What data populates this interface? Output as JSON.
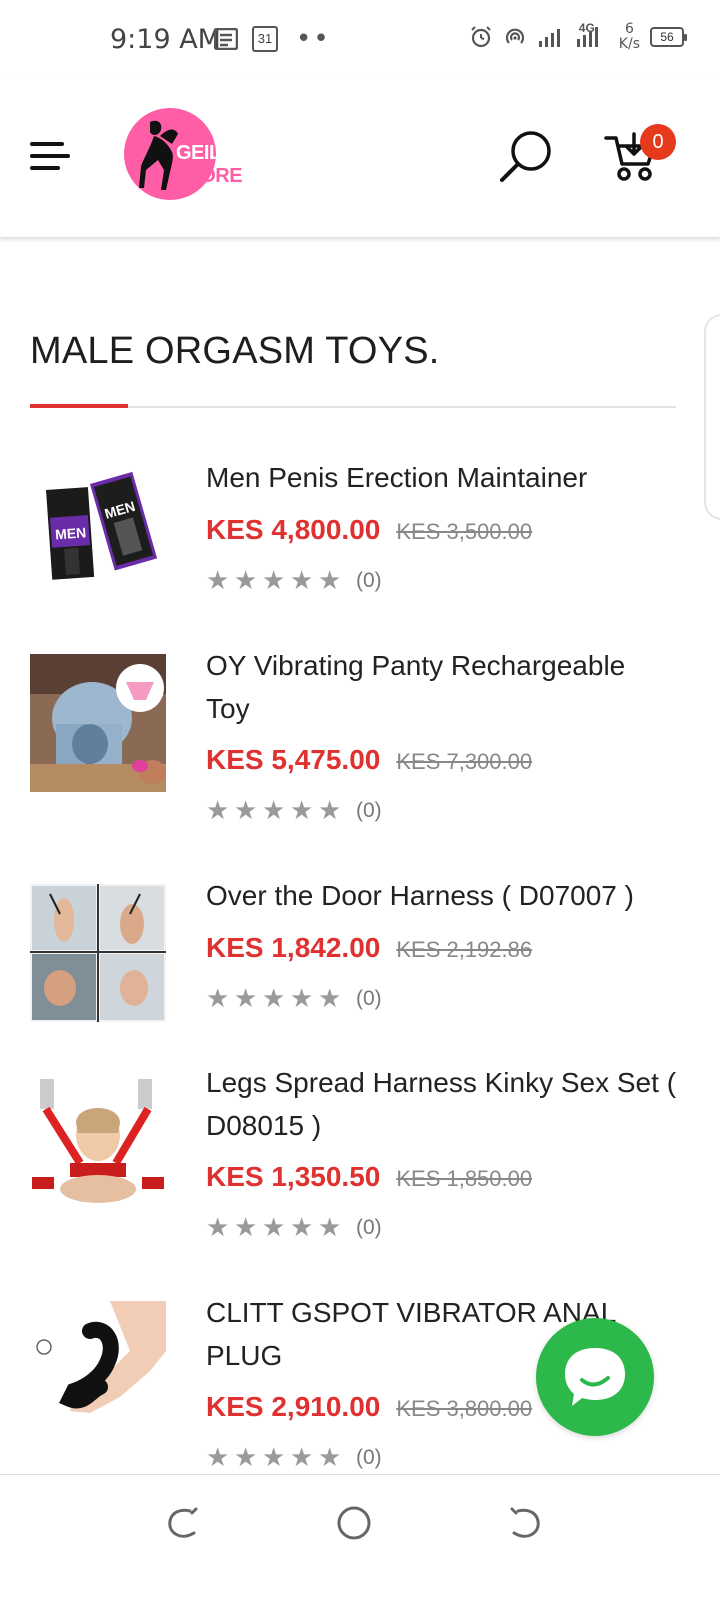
{
  "status_bar": {
    "time": "9:19 AM",
    "calendar_day": "31",
    "net_speed_value": "6",
    "net_speed_unit": "K/s",
    "network": "4G",
    "battery": "56"
  },
  "header": {
    "logo_text_a": "GEIL",
    "logo_text_b": "STORE",
    "cart_count": "0"
  },
  "section": {
    "title": "MALE ORGASM TOYS."
  },
  "products": [
    {
      "name": "Men Penis Erection Maintainer",
      "price": "KES 4,800.00",
      "old_price": "KES 3,500.00",
      "rating_count": "(0)"
    },
    {
      "name": "OY Vibrating Panty Rechargeable Toy",
      "price": "KES 5,475.00",
      "old_price": "KES 7,300.00",
      "rating_count": "(0)"
    },
    {
      "name": "Over the Door Harness ( D07007 )",
      "price": "KES 1,842.00",
      "old_price": "KES 2,192.86",
      "rating_count": "(0)"
    },
    {
      "name": "Legs Spread Harness Kinky Sex Set ( D08015 )",
      "price": "KES 1,350.50",
      "old_price": "KES 1,850.00",
      "rating_count": "(0)"
    },
    {
      "name": "CLITT GSPOT VIBRATOR ANAL PLUG",
      "price": "KES 2,910.00",
      "old_price": "KES 3,800.00",
      "rating_count": "(0)"
    }
  ],
  "colors": {
    "accent": "#e03131",
    "logo_pink": "#ff5ea6",
    "chat_green": "#2db84b",
    "badge": "#e53a1c"
  },
  "icons": {
    "menu": "hamburger-icon",
    "search": "search-icon",
    "cart": "cart-icon",
    "chat": "chat-icon",
    "nav_back": "back-nav-icon",
    "nav_home": "home-nav-icon",
    "nav_recents": "recents-nav-icon"
  }
}
